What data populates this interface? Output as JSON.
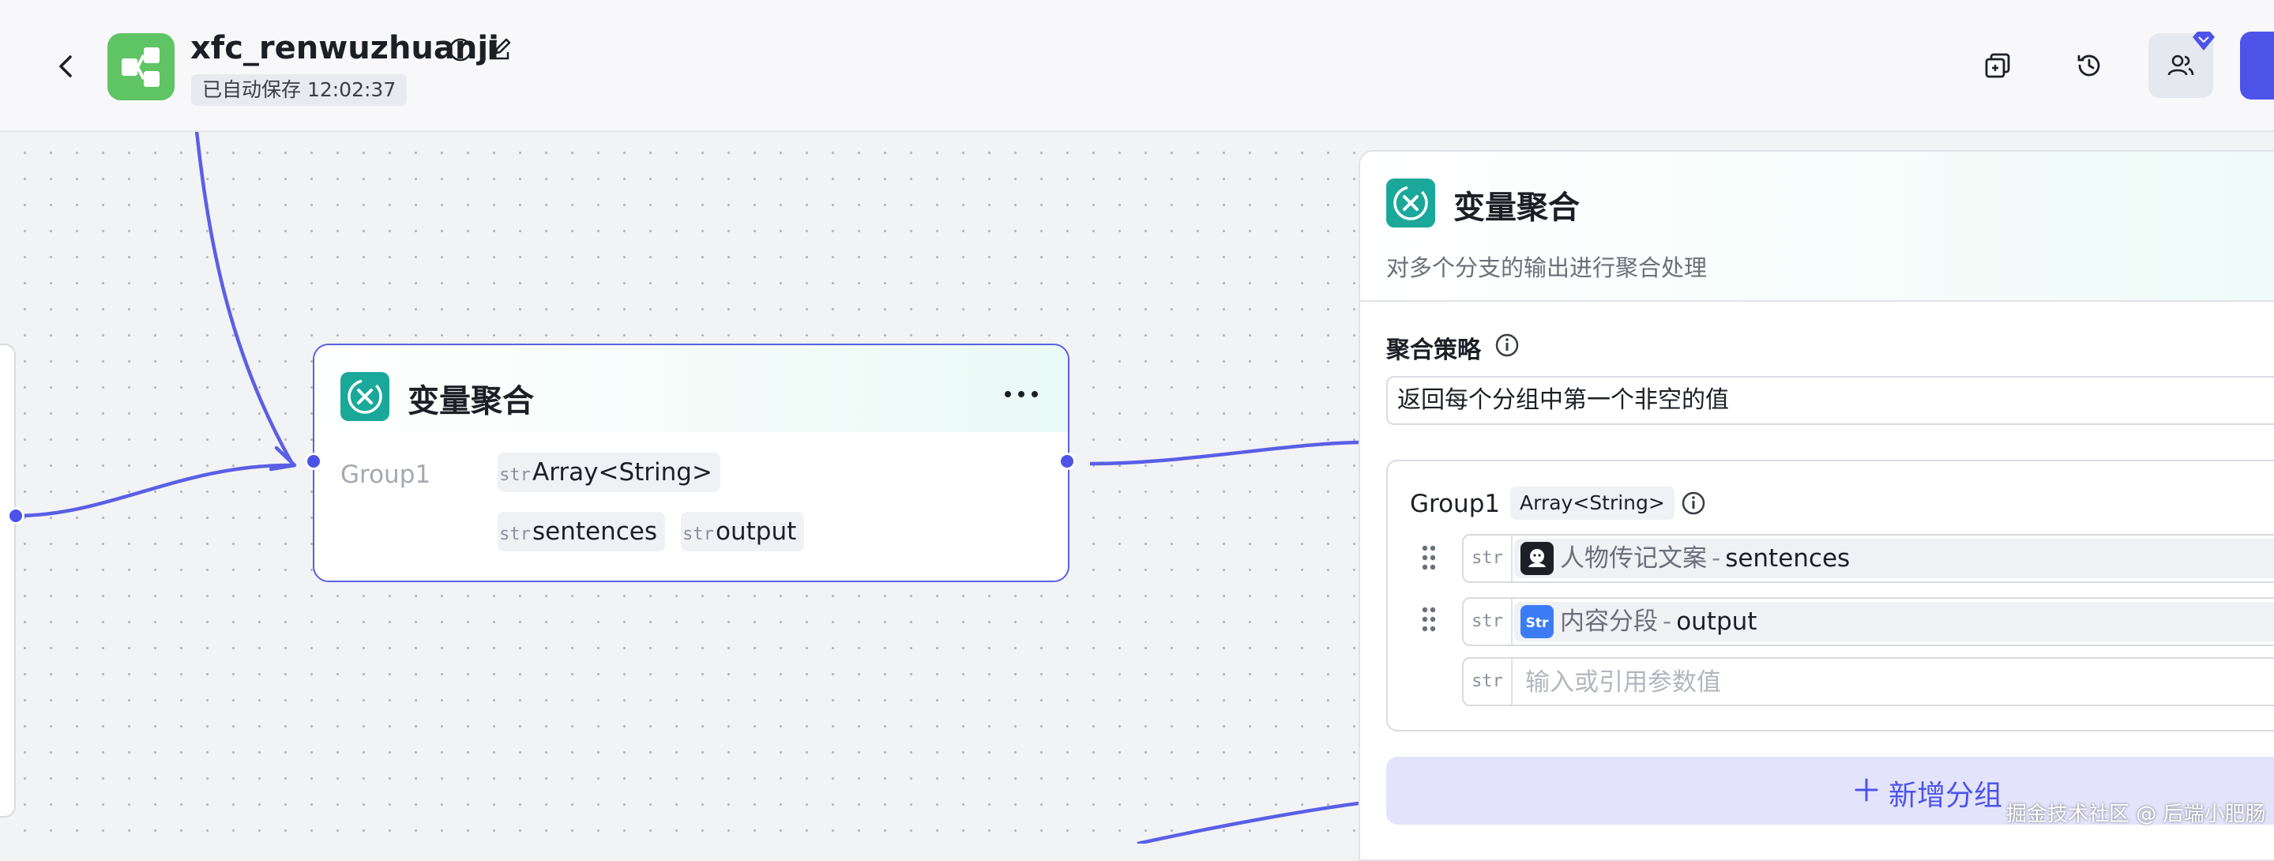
{
  "header": {
    "title": "xfc_renwuzhuanji",
    "autosave": "已自动保存 12:02:37"
  },
  "node": {
    "title": "变量聚合",
    "group_label": "Group1",
    "type_tag": "Array<String>",
    "var_tags": [
      "sentences",
      "output"
    ],
    "str_icon": "str"
  },
  "panel": {
    "title": "变量聚合",
    "description": "对多个分支的输出进行聚合处理",
    "strategy_label": "聚合策略",
    "strategy_value": "返回每个分组中第一个非空的值",
    "group": {
      "name": "Group1",
      "type": "Array<String>",
      "rows": [
        {
          "source": "人物传记文案",
          "separator": "-",
          "variable": "sentences",
          "icon": "bot-avatar-icon"
        },
        {
          "source": "内容分段",
          "separator": "-",
          "variable": "output",
          "icon": "str-plugin-icon"
        }
      ],
      "input_placeholder": "输入或引用参数值",
      "str_icon": "str"
    },
    "add_group_label": "新增分组"
  },
  "watermark": "掘金技术社区 @ 后端小肥肠",
  "colors": {
    "accent": "#4d53e8",
    "node_icon": "#1aa89a",
    "app_logo": "#5fc463"
  }
}
